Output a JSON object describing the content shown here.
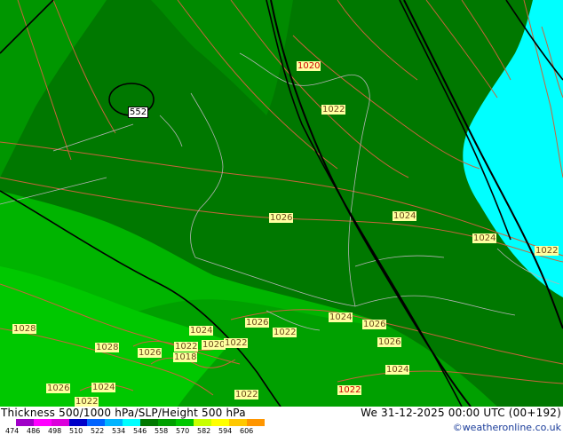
{
  "map": {
    "pressure_labels": [
      {
        "text": "1020",
        "style": "red"
      },
      {
        "text": "1022",
        "style": "red"
      },
      {
        "text": "1026",
        "style": "red"
      },
      {
        "text": "1024",
        "style": "red"
      },
      {
        "text": "1024",
        "style": "red"
      },
      {
        "text": "1022",
        "style": "red"
      },
      {
        "text": "1028",
        "style": "red"
      },
      {
        "text": "1026",
        "style": "red"
      },
      {
        "text": "1024",
        "style": "red"
      },
      {
        "text": "1024",
        "style": "red"
      },
      {
        "text": "1026",
        "style": "red"
      },
      {
        "text": "1028",
        "style": "red"
      },
      {
        "text": "1026",
        "style": "red"
      },
      {
        "text": "1022",
        "style": "red"
      },
      {
        "text": "1020",
        "style": "red"
      },
      {
        "text": "1022",
        "style": "red"
      },
      {
        "text": "1022",
        "style": "red"
      },
      {
        "text": "1018",
        "style": "red"
      },
      {
        "text": "1026",
        "style": "red"
      },
      {
        "text": "1026",
        "style": "red"
      },
      {
        "text": "1024",
        "style": "red"
      },
      {
        "text": "1022",
        "style": "red"
      },
      {
        "text": "1022",
        "style": "red"
      },
      {
        "text": "1024",
        "style": "red"
      },
      {
        "text": "1022",
        "style": "red"
      }
    ],
    "height_labels": [
      {
        "text": "552"
      }
    ],
    "colors": {
      "thickness_light_green": "#00c800",
      "thickness_mid_green": "#00a000",
      "thickness_dark_green": "#007800",
      "thickness_cyan": "#00ffff",
      "isobar_line": "#c8643c",
      "height_line": "#000000",
      "border_line": "#aaaaaa"
    }
  },
  "footer": {
    "title": "Thickness 500/1000 hPa/SLP/Height 500 hPa",
    "datetime": "We 31-12-2025 00:00 UTC (00+192)",
    "credit": "©weatheronline.co.uk",
    "scale_ticks": [
      "474",
      "486",
      "498",
      "510",
      "522",
      "534",
      "546",
      "558",
      "570",
      "582",
      "594",
      "606"
    ],
    "scale_colors": [
      "#a000c8",
      "#ff00ff",
      "#dc00dc",
      "#0000c8",
      "#0064ff",
      "#00b4ff",
      "#00ffff",
      "#007800",
      "#00a000",
      "#00c800",
      "#c8ff00",
      "#ffff00",
      "#ffc800",
      "#ff9600"
    ]
  }
}
